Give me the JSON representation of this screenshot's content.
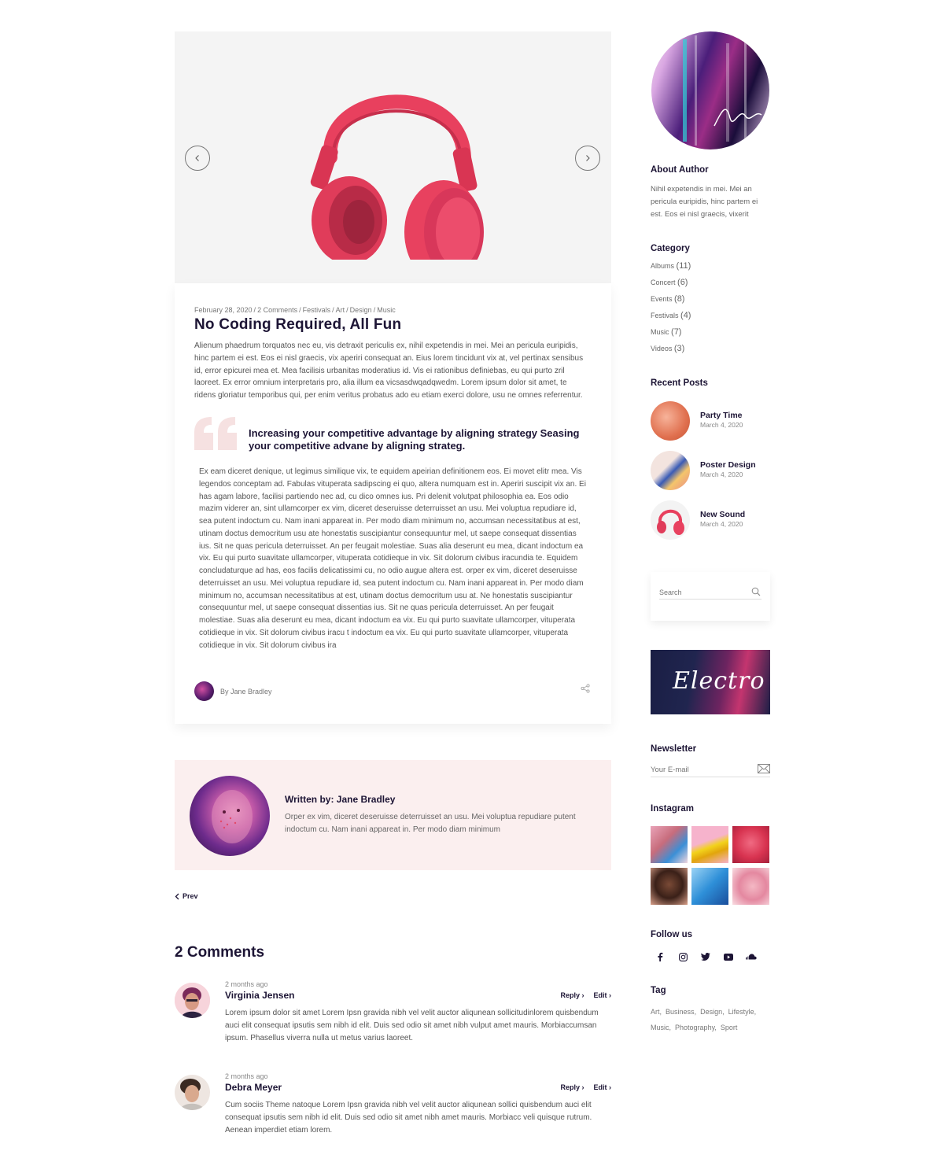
{
  "post": {
    "meta": {
      "date": "February 28, 2020",
      "comments": "2 Comments",
      "categories": [
        "Festivals",
        "Art",
        "Design",
        "Music"
      ]
    },
    "title": "No Coding Required, All Fun",
    "intro": "Alienum phaedrum torquatos nec eu, vis detraxit periculis ex, nihil expetendis in mei. Mei an pericula euripidis, hinc partem ei est. Eos ei nisl graecis, vix aperiri consequat an. Eius lorem tincidunt vix at, vel pertinax sensibus id, error epicurei mea et. Mea facilisis urbanitas moderatius id. Vis ei rationibus definiebas, eu qui purto zril laoreet. Ex error omnium interpretaris pro, alia illum ea vicsasdwqadqwedm. Lorem ipsum dolor sit amet, te ridens gloriatur temporibus qui, per enim veritus probatus ado eu etiam exerci dolore, usu ne omnes referrentur.",
    "quote": "Increasing your competitive advantage by aligning strategy Seasing your competitive advane by aligning strateg.",
    "body": "Ex eam diceret denique, ut legimus similique vix, te equidem apeirian definitionem eos. Ei movet elitr mea. Vis legendos conceptam ad. Fabulas vituperata sadipscing ei quo, altera numquam est in. Aperiri suscipit vix an. Ei has agam labore, facilisi partiendo nec ad, cu dico omnes ius. Pri delenit volutpat philosophia ea. Eos odio mazim viderer an, sint ullamcorper ex vim, diceret deseruisse deterruisset an usu. Mei voluptua repudiare id, sea putent indoctum cu. Nam inani appareat in. Per modo diam minimum no, accumsan necessitatibus at est, utinam doctus democritum usu ate honestatis suscipiantur consequuntur mel, ut saepe consequat dissentias ius. Sit ne quas pericula deterruisset. An per feugait molestiae. Suas alia deserunt eu mea, dicant indoctum ea vix. Eu qui purto suavitate ullamcorper, vituperata cotidieque in vix. Sit dolorum civibus iracundia te. Equidem concludaturque ad has, eos facilis delicatissimi cu, no odio augue altera est. orper ex vim, diceret deseruisse deterruisset an usu. Mei voluptua repudiare id, sea putent indoctum cu. Nam inani appareat in. Per modo diam minimum no, accumsan necessitatibus at est, utinam doctus democritum usu at. Ne honestatis suscipiantur consequuntur mel, ut saepe consequat dissentias ius. Sit ne quas pericula deterruisset. An per feugait molestiae. Suas alia deserunt eu mea, dicant indoctum ea vix. Eu qui purto suavitate ullamcorper, vituperata cotidieque in vix. Sit dolorum civibus iracu t indoctum ea vix. Eu qui purto suavitate ullamcorper, vituperata cotidieque in vix. Sit dolorum civibus ira",
    "author": "By Jane Bradley"
  },
  "author_box": {
    "title": "Written by: Jane Bradley",
    "text": "Orper ex vim, diceret deseruisse deterruisset an usu. Mei voluptua repudiare putent indoctum cu. Nam inani appareat in. Per modo diam minimum"
  },
  "nav": {
    "prev": "Prev"
  },
  "comments": {
    "title": "2 Comments",
    "items": [
      {
        "time": "2 months ago",
        "name": "Virginia Jensen",
        "reply": "Reply",
        "edit": "Edit",
        "text": "Lorem ipsum dolor sit amet Lorem Ipsn gravida nibh vel velit auctor aliqunean sollicitudinlorem quisbendum auci elit consequat ipsutis sem nibh id elit. Duis sed odio sit amet nibh vulput amet mauris. Morbiaccumsan ipsum. Phasellus viverra nulla ut metus varius laoreet."
      },
      {
        "time": "2 months ago",
        "name": "Debra Meyer",
        "reply": "Reply",
        "edit": "Edit",
        "text": "Cum sociis Theme natoque Lorem Ipsn gravida nibh vel velit auctor aliqunean sollici quisbendum auci elit consequat ipsutis sem nibh id elit. Duis sed odio sit amet nibh amet mauris. Morbiacc veli quisque rutrum. Aenean imperdiet etiam lorem."
      }
    ]
  },
  "sidebar": {
    "about": {
      "title": "About Author",
      "text": "Nihil expetendis in mei. Mei an pericula euripidis, hinc partem ei est. Eos ei nisl graecis, vixerit"
    },
    "category": {
      "title": "Category",
      "items": [
        {
          "label": "Albums",
          "count": "(11)"
        },
        {
          "label": "Concert",
          "count": "(6)"
        },
        {
          "label": "Events",
          "count": "(8)"
        },
        {
          "label": "Festivals",
          "count": "(4)"
        },
        {
          "label": "Music",
          "count": "(7)"
        },
        {
          "label": "Videos",
          "count": "(3)"
        }
      ]
    },
    "recent": {
      "title": "Recent Posts",
      "items": [
        {
          "title": "Party Time",
          "date": "March 4, 2020"
        },
        {
          "title": "Poster Design",
          "date": "March 4, 2020"
        },
        {
          "title": "New Sound",
          "date": "March 4, 2020"
        }
      ]
    },
    "search": {
      "placeholder": "Search"
    },
    "banner": {
      "text": "Electro"
    },
    "newsletter": {
      "title": "Newsletter",
      "placeholder": "Your E-mail"
    },
    "instagram": {
      "title": "Instagram"
    },
    "follow": {
      "title": "Follow us",
      "icons": [
        "facebook-icon",
        "instagram-icon",
        "twitter-icon",
        "youtube-icon",
        "soundcloud-icon"
      ]
    },
    "tags": {
      "title": "Tag",
      "items": [
        "Art",
        "Business",
        "Design",
        "Lifestyle",
        "Music",
        "Photography",
        "Sport"
      ]
    }
  },
  "colors": {
    "accent": "#e73d5c",
    "dark": "#1d1535",
    "author_box_bg": "#fbefef"
  }
}
